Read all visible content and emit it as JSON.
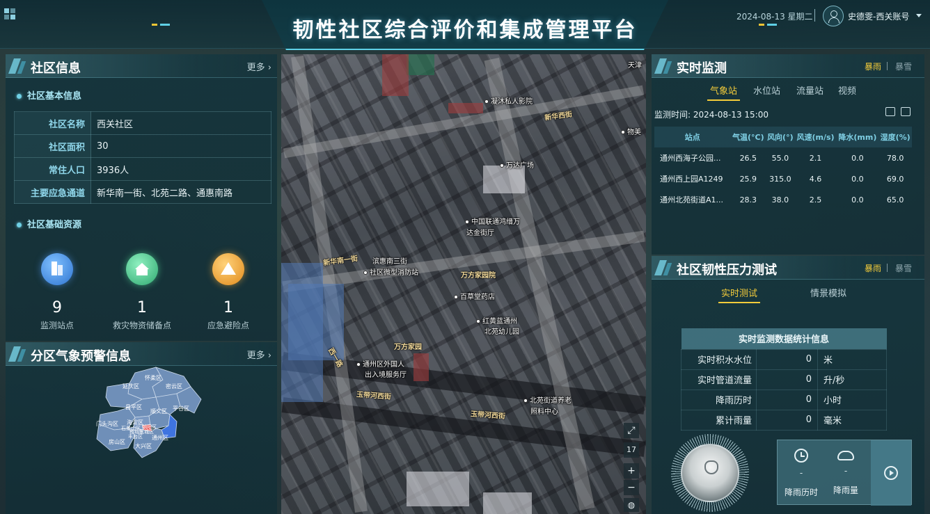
{
  "header": {
    "title": "韧性社区综合评价和集成管理平台",
    "date": "2024-08-13 星期二",
    "user": "史德雯-西关账号"
  },
  "community": {
    "section_title": "社区信息",
    "more": "更多",
    "basic_title": "社区基本信息",
    "rows": [
      {
        "k": "社区名称",
        "v": "西关社区"
      },
      {
        "k": "社区面积",
        "v": "30"
      },
      {
        "k": "常住人口",
        "v": "3936人"
      },
      {
        "k": "主要应急通道",
        "v": "新华南一街、北苑二路、通惠南路"
      }
    ],
    "resources_title": "社区基础资源",
    "resources": [
      {
        "num": "9",
        "label": "监测站点",
        "icon": "building-icon",
        "color": "#3f8de0"
      },
      {
        "num": "1",
        "label": "救灾物资储备点",
        "icon": "warehouse-icon",
        "color": "#3fbf8a"
      },
      {
        "num": "1",
        "label": "应急避险点",
        "icon": "tent-icon",
        "color": "#e89a2c"
      }
    ]
  },
  "weather_warning": {
    "section_title": "分区气象预警信息",
    "more": "更多",
    "districts": [
      "延庆区",
      "怀柔区",
      "密云区",
      "昌平区",
      "顺义区",
      "平谷区",
      "门头沟区",
      "海淀区",
      "朝阳区",
      "石景山区",
      "西城区",
      "东城区",
      "丰台区",
      "通州区",
      "房山区",
      "大兴区"
    ]
  },
  "map": {
    "labels": [
      {
        "text": "凝沐私人影院"
      },
      {
        "text": "新华西街"
      },
      {
        "text": "物美"
      },
      {
        "text": "万达广场"
      },
      {
        "text": "中国联通鸿缙万"
      },
      {
        "text": "达金街厅"
      },
      {
        "text": "滨惠南三街"
      },
      {
        "text": "社区微型消防站"
      },
      {
        "text": "万方家园院"
      },
      {
        "text": "百草堂药店"
      },
      {
        "text": "红黄蓝通州"
      },
      {
        "text": "北苑幼儿园"
      },
      {
        "text": "万方家园"
      },
      {
        "text": "通州区外国人"
      },
      {
        "text": "出入境服务厅"
      },
      {
        "text": "北苑街道养老"
      },
      {
        "text": "照料中心"
      },
      {
        "text": "天津"
      }
    ],
    "roads": [
      "新华南一街",
      "玉带河西街",
      "玉带河西街",
      "西一路"
    ],
    "zoom": "17"
  },
  "monitor": {
    "section_title": "实时监测",
    "modes": [
      "暴雨",
      "暴雪"
    ],
    "tabs": [
      "气象站",
      "水位站",
      "流量站",
      "视频"
    ],
    "time_label": "监测时间: 2024-08-13 15:00",
    "columns": [
      "站点",
      "气温(°C)",
      "风向(°)",
      "风速(m/s)",
      "降水(mm)",
      "湿度(%)"
    ],
    "rows": [
      [
        "通州西海子公园...",
        "26.5",
        "55.0",
        "2.1",
        "0.0",
        "78.0"
      ],
      [
        "通州西上园A1249",
        "25.9",
        "315.0",
        "4.6",
        "0.0",
        "69.0"
      ],
      [
        "通州北苑街道A1...",
        "28.3",
        "38.0",
        "2.5",
        "0.0",
        "65.0"
      ]
    ]
  },
  "pressure": {
    "section_title": "社区韧性压力测试",
    "modes": [
      "暴雨",
      "暴雪"
    ],
    "tabs": [
      "实时测试",
      "情景模拟"
    ],
    "table_title": "实时监测数据统计信息",
    "rows": [
      {
        "k": "实时积水水位",
        "v": "0",
        "u": "米"
      },
      {
        "k": "实时管道流量",
        "v": "0",
        "u": "升/秒"
      },
      {
        "k": "降雨历时",
        "v": "0",
        "u": "小时"
      },
      {
        "k": "累计雨量",
        "v": "0",
        "u": "毫米"
      }
    ],
    "controls": [
      {
        "label": "降雨历时",
        "value": "-"
      },
      {
        "label": "降雨量",
        "value": "-"
      }
    ]
  },
  "colors": {
    "accent": "#f4cc3a",
    "cyan": "#6fd0e5"
  }
}
